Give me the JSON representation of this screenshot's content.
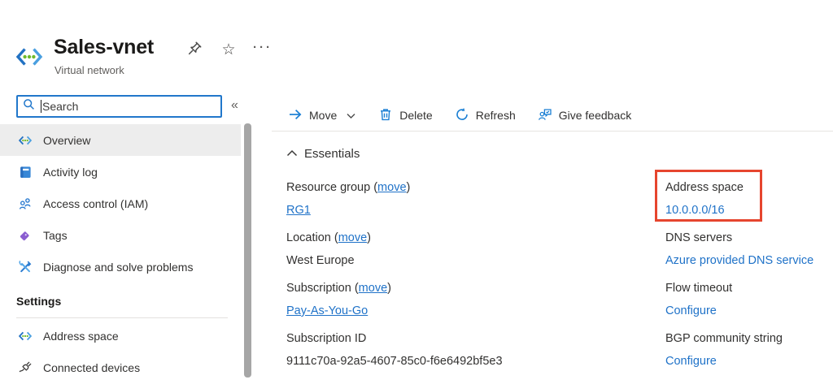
{
  "header": {
    "title": "Sales-vnet",
    "subtitle": "Virtual network",
    "star_glyph": "☆",
    "more_glyph": "···"
  },
  "sidebar": {
    "search_placeholder": "Search",
    "collapse_glyph": "«",
    "items": [
      {
        "label": "Overview",
        "icon": "virtual-network-icon",
        "selected": true
      },
      {
        "label": "Activity log",
        "icon": "activity-log-icon"
      },
      {
        "label": "Access control (IAM)",
        "icon": "access-control-icon"
      },
      {
        "label": "Tags",
        "icon": "tags-icon"
      },
      {
        "label": "Diagnose and solve problems",
        "icon": "diagnose-icon"
      }
    ],
    "settings_section": {
      "title": "Settings",
      "items": [
        {
          "label": "Address space",
          "icon": "address-space-icon"
        },
        {
          "label": "Connected devices",
          "icon": "connected-devices-icon"
        }
      ]
    }
  },
  "toolbar": {
    "move_label": "Move",
    "delete_label": "Delete",
    "refresh_label": "Refresh",
    "feedback_label": "Give feedback"
  },
  "essentials": {
    "title": "Essentials",
    "punct": {
      "open": "(",
      "close": ")"
    },
    "left": [
      {
        "label": "Resource group",
        "move_link": "move",
        "value": "RG1"
      },
      {
        "label": "Location",
        "move_link": "move",
        "value": "West Europe"
      },
      {
        "label": "Subscription",
        "move_link": "move",
        "value": "Pay-As-You-Go"
      },
      {
        "label": "Subscription ID",
        "value": "9111c70a-92a5-4607-85c0-f6e6492bf5e3"
      }
    ],
    "right": [
      {
        "label": "Address space",
        "value": "10.0.0.0/16",
        "highlighted": true
      },
      {
        "label": "DNS servers",
        "value": "Azure provided DNS service"
      },
      {
        "label": "Flow timeout",
        "value": "Configure"
      },
      {
        "label": "BGP community string",
        "value": "Configure"
      }
    ]
  },
  "colors": {
    "link_blue": "#1f72c8",
    "toolbar_icon_blue": "#1a7fd4",
    "highlight_red": "#e6452e",
    "selected_item_bg": "#ededed"
  }
}
